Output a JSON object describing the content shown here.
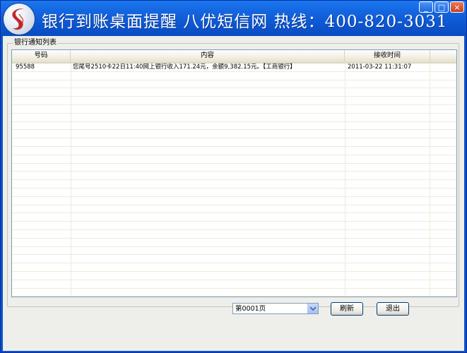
{
  "window": {
    "title": "银行到账桌面提醒   八优短信网 热线：400-820-3031",
    "buttons": {
      "minimize": "_",
      "maximize": "□",
      "close": "×"
    },
    "colors": {
      "titlebar": "#0c55d0",
      "logo_accent": "#c0282d"
    },
    "logo_icon": "s-logo-icon"
  },
  "list": {
    "group_label": "银行通知列表",
    "columns": [
      "号码",
      "内容",
      "接收时间"
    ],
    "rows": [
      {
        "number": "95588",
        "content": "您尾号2510卡22日11:40网上银行收入171.24元，余额9,382.15元。【工商银行】",
        "time": "2011-03-22 11:31:07"
      }
    ]
  },
  "footer": {
    "page_select": "第0001页",
    "refresh_label": "刷新",
    "exit_label": "退出"
  }
}
